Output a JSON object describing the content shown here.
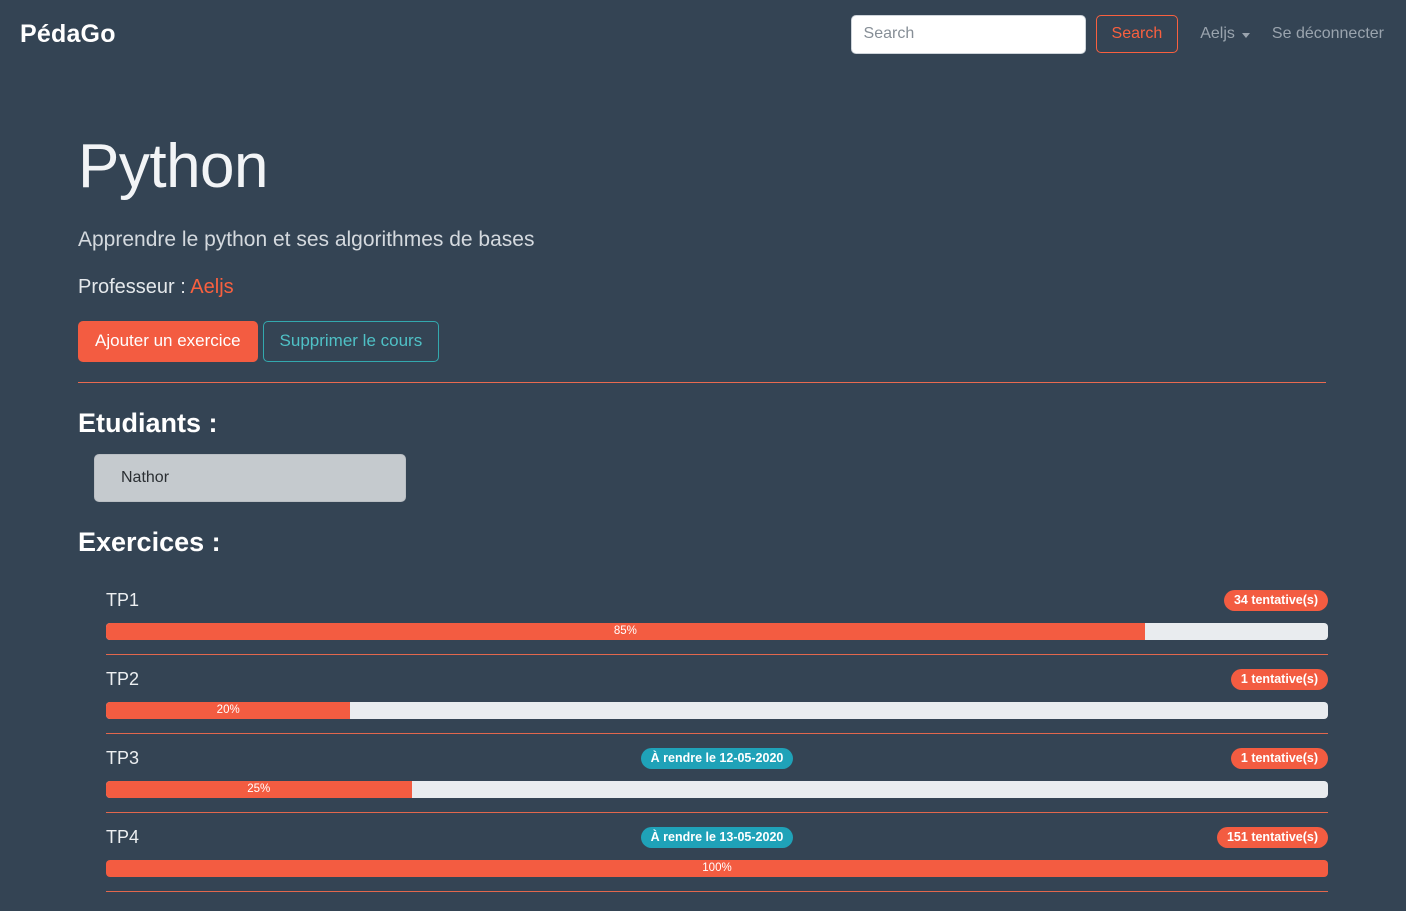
{
  "navbar": {
    "brand": "PédaGo",
    "search": {
      "placeholder": "Search",
      "value": "",
      "button_label": "Search"
    },
    "user_menu_label": "Aeljs",
    "logout_label": "Se déconnecter"
  },
  "course": {
    "title": "Python",
    "description": "Apprendre le python et ses algorithmes de bases",
    "professor_label": "Professeur :",
    "professor_name": "Aeljs",
    "add_exercise_label": "Ajouter un exercice",
    "delete_course_label": "Supprimer le cours"
  },
  "students": {
    "heading": "Etudiants :",
    "items": [
      {
        "name": "Nathor"
      }
    ]
  },
  "exercises": {
    "heading": "Exercices :",
    "items": [
      {
        "name": "TP1",
        "due_badge": "",
        "attempts_badge": "34 tentative(s)",
        "progress_label": "85%",
        "progress_percent": 85
      },
      {
        "name": "TP2",
        "due_badge": "",
        "attempts_badge": "1 tentative(s)",
        "progress_label": "20%",
        "progress_percent": 20
      },
      {
        "name": "TP3",
        "due_badge": "À rendre le 12-05-2020",
        "attempts_badge": "1 tentative(s)",
        "progress_label": "25%",
        "progress_percent": 25
      },
      {
        "name": "TP4",
        "due_badge": "À rendre le 13-05-2020",
        "attempts_badge": "151 tentative(s)",
        "progress_label": "100%",
        "progress_percent": 100
      }
    ]
  },
  "colors": {
    "background": "#344454",
    "accent_red": "#f35c41",
    "accent_teal": "#1fa2b8",
    "progress_track": "#e9ecef",
    "student_bg": "#c5cace"
  }
}
